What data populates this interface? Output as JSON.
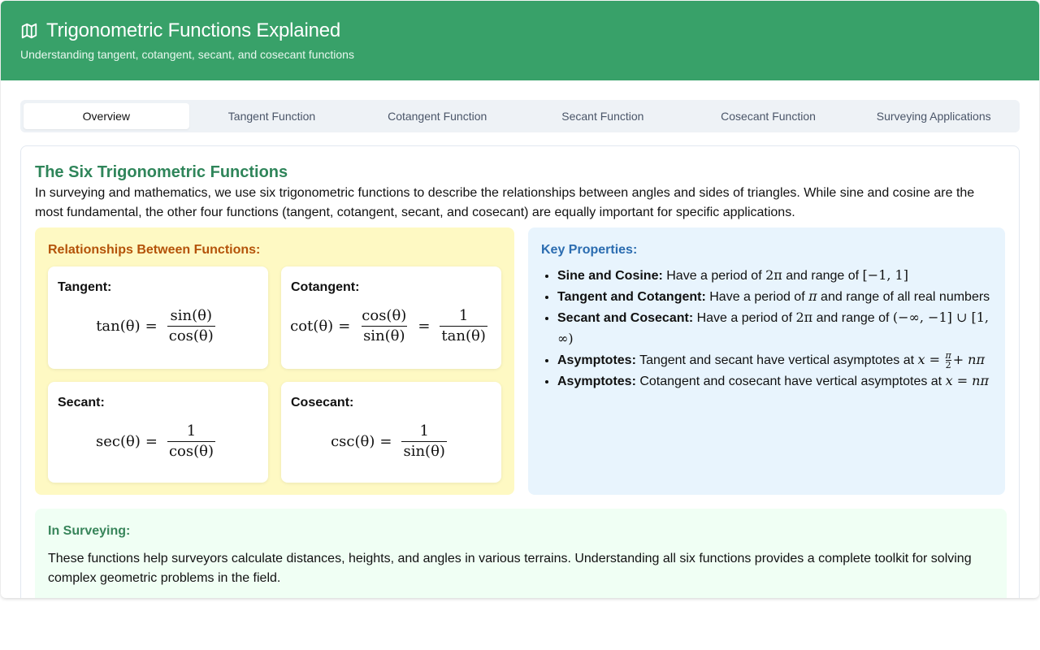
{
  "header": {
    "title": "Trigonometric Functions Explained",
    "subtitle": "Understanding tangent, cotangent, secant, and cosecant functions",
    "icon": "map-icon"
  },
  "tabs": [
    {
      "label": "Overview",
      "active": true
    },
    {
      "label": "Tangent Function",
      "active": false
    },
    {
      "label": "Cotangent Function",
      "active": false
    },
    {
      "label": "Secant Function",
      "active": false
    },
    {
      "label": "Cosecant Function",
      "active": false
    },
    {
      "label": "Surveying Applications",
      "active": false
    }
  ],
  "main": {
    "title": "The Six Trigonometric Functions",
    "intro": "In surveying and mathematics, we use six trigonometric functions to describe the relationships between angles and sides of triangles. While sine and cosine are the most fundamental, the other four functions (tangent, cotangent, secant, and cosecant) are equally important for specific applications."
  },
  "relationships": {
    "title": "Relationships Between Functions:",
    "cards": [
      {
        "name": "Tangent:",
        "lhs": "tan(θ)",
        "rhs1_num": "sin(θ)",
        "rhs1_den": "cos(θ)"
      },
      {
        "name": "Cotangent:",
        "lhs": "cot(θ)",
        "rhs1_num": "cos(θ)",
        "rhs1_den": "sin(θ)",
        "rhs2_num": "1",
        "rhs2_den": "tan(θ)"
      },
      {
        "name": "Secant:",
        "lhs": "sec(θ)",
        "rhs1_num": "1",
        "rhs1_den": "cos(θ)"
      },
      {
        "name": "Cosecant:",
        "lhs": "csc(θ)",
        "rhs1_num": "1",
        "rhs1_den": "sin(θ)"
      }
    ]
  },
  "properties": {
    "title": "Key Properties:",
    "items": [
      {
        "label": "Sine and Cosine:",
        "t1": " Have a period of ",
        "m1": "2π",
        "t2": " and range of ",
        "m2": "[−1, 1]"
      },
      {
        "label": "Tangent and Cotangent:",
        "t1": " Have a period of ",
        "m1": "π",
        "t2": " and range of all real numbers"
      },
      {
        "label": "Secant and Cosecant:",
        "t1": " Have a period of ",
        "m1": "2π",
        "t2": " and range of ",
        "m2": "(−∞, −1] ∪ [1, ∞)"
      },
      {
        "label": "Asymptotes:",
        "t1": " Tangent and secant have vertical asymptotes at ",
        "m1": "x =",
        "frac_num": "π",
        "frac_den": "2",
        "m2": "+ nπ"
      },
      {
        "label": "Asymptotes:",
        "t1": " Cotangent and cosecant have vertical asymptotes at ",
        "m1": "x = nπ"
      }
    ]
  },
  "surveying": {
    "title": "In Surveying:",
    "text": "These functions help surveyors calculate distances, heights, and angles in various terrains. Understanding all six functions provides a complete toolkit for solving complex geometric problems in the field."
  }
}
